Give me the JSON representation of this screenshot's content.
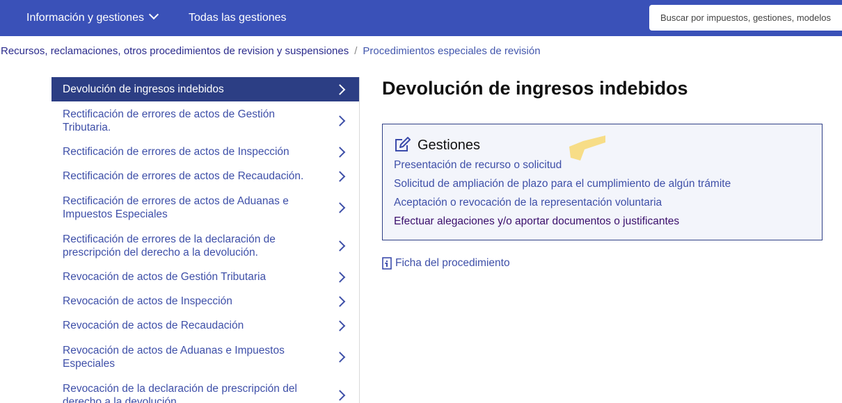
{
  "header": {
    "nav_info": "Información y gestiones",
    "nav_all": "Todas las gestiones",
    "search_placeholder": "Buscar por impuestos, gestiones, modelos"
  },
  "breadcrumb": {
    "items": [
      "Recursos, reclamaciones, otros procedimientos de revision y suspensiones",
      "Procedimientos especiales de revisión"
    ],
    "separator": "/"
  },
  "sidebar": {
    "items": [
      {
        "label": "Devolución de ingresos indebidos",
        "active": true
      },
      {
        "label": "Rectificación de errores de actos de Gestión Tributaria."
      },
      {
        "label": "Rectificación de errores de actos de Inspección"
      },
      {
        "label": "Rectificación de errores de actos de Recaudación."
      },
      {
        "label": "Rectificación de errores de actos de Aduanas e Impuestos Especiales"
      },
      {
        "label": "Rectificación de errores de la declaración de prescripción del derecho a la devolución."
      },
      {
        "label": "Revocación de actos de Gestión Tributaria"
      },
      {
        "label": "Revocación de actos de Inspección"
      },
      {
        "label": "Revocación de actos de Recaudación"
      },
      {
        "label": "Revocación de actos de Aduanas e Impuestos Especiales"
      },
      {
        "label": "Revocación de la declaración de prescripción del derecho a la devolución."
      }
    ]
  },
  "main": {
    "title": "Devolución de ingresos indebidos",
    "gestiones": {
      "heading": "Gestiones",
      "links": [
        "Presentación de recurso o solicitud",
        "Solicitud de ampliación de plazo para el cumplimiento de algún trámite",
        "Aceptación o revocación de la representación voluntaria",
        "Efectuar alegaciones y/o aportar documentos o justificantes"
      ]
    },
    "ficha": "Ficha del procedimiento"
  },
  "colors": {
    "header_bg": "#3a51b8",
    "active_item_bg": "#2c3e84",
    "link": "#3e4fa8",
    "visited_link": "#3a0e6b",
    "panel_bg": "#f3f5fb",
    "highlight": "#f7d76a"
  }
}
